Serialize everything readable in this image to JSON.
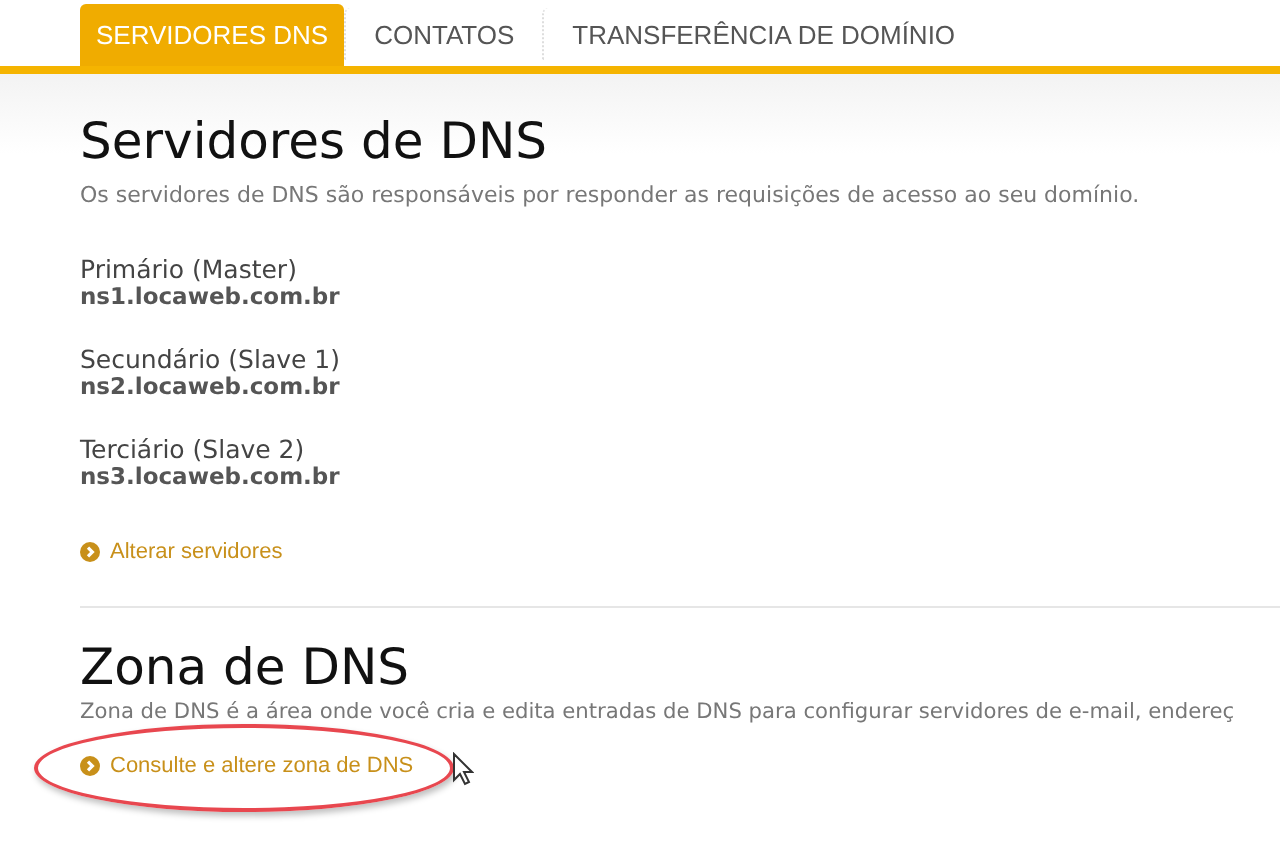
{
  "tabs": [
    {
      "label": "SERVIDORES DNS",
      "selected": true
    },
    {
      "label": "CONTATOS",
      "selected": false
    },
    {
      "label": "TRANSFERÊNCIA DE DOMÍNIO",
      "selected": false
    }
  ],
  "servers_section": {
    "title": "Servidores de DNS",
    "description": "Os servidores de DNS são responsáveis por responder as requisições de acesso ao seu domínio.",
    "servers": [
      {
        "label": "Primário (Master)",
        "host": "ns1.locaweb.com.br"
      },
      {
        "label": "Secundário (Slave 1)",
        "host": "ns2.locaweb.com.br"
      },
      {
        "label": "Terciário (Slave 2)",
        "host": "ns3.locaweb.com.br"
      }
    ],
    "link": "Alterar servidores"
  },
  "zone_section": {
    "title": "Zona de DNS",
    "description": "Zona de DNS é a área onde você cria e edita entradas de DNS para configurar servidores de e-mail, endereç",
    "link": "Consulte e altere zona de DNS",
    "highlighted": true
  }
}
